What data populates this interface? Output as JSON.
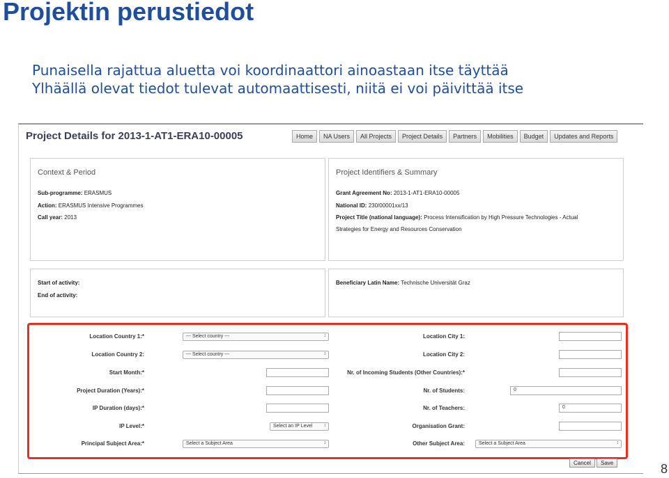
{
  "slide": {
    "title": "Projektin perustiedot",
    "note_1": "Punaisella rajattua aluetta voi koordinaattori ainoastaan itse täyttää",
    "note_2": "Ylhäällä olevat tiedot tulevat automaattisesti, niitä ei voi päivittää itse",
    "page_number": "8",
    "highlight_color": "#e53125"
  },
  "app": {
    "header": "Project Details for 2013-1-AT1-ERA10-00005",
    "nav": [
      "Home",
      "NA Users",
      "All Projects",
      "Project Details",
      "Partners",
      "Mobilities",
      "Budget",
      "Updates and Reports"
    ]
  },
  "context_panel": {
    "heading": "Context & Period",
    "subprogramme_label": "Sub-programme:",
    "subprogramme_value": "ERASMUS",
    "action_label": "Action:",
    "action_value": "ERASMUS Intensive Programmes",
    "call_year_label": "Call year:",
    "call_year_value": "2013"
  },
  "identifiers_panel": {
    "heading": "Project Identifiers & Summary",
    "grant_label": "Grant Agreement No:",
    "grant_value": "2013-1-AT1-ERA10-00005",
    "national_id_label": "National ID:",
    "national_id_value": "230/00001xx/13",
    "title_label": "Project Title (national language):",
    "title_value": "Process Intensification by High Pressure Technologies - Actual",
    "title_value_cont": "Strategies for Energy and Resources Conservation"
  },
  "activity_panel": {
    "start_label": "Start of activity:",
    "end_label": "End of activity:"
  },
  "beneficiary_panel": {
    "label": "Beneficiary Latin Name:",
    "value": "Technische Universität Graz"
  },
  "form": {
    "location_country_1": "Location Country 1:*",
    "location_country_2": "Location Country 2:",
    "select_country": "--- Select country ---",
    "start_month": "Start Month:*",
    "project_duration": "Project Duration (Years):*",
    "ip_duration": "IP Duration (days):*",
    "ip_level": "IP Level:*",
    "select_ip_level": "Select an IP Level",
    "principal_subject": "Principal Subject Area:*",
    "select_subject": "Select a Subject Area",
    "location_city_1": "Location City 1:",
    "location_city_2": "Location City 2:",
    "incoming_students": "Nr. of Incoming Students (Other Countries):*",
    "nr_students": "Nr. of Students:",
    "nr_students_value": "0",
    "nr_teachers": "Nr. of Teachers:",
    "nr_teachers_value": "0",
    "organisation_grant": "Organisation Grant:",
    "other_subject": "Other Subject Area:",
    "cancel": "Cancel",
    "save": "Save"
  }
}
